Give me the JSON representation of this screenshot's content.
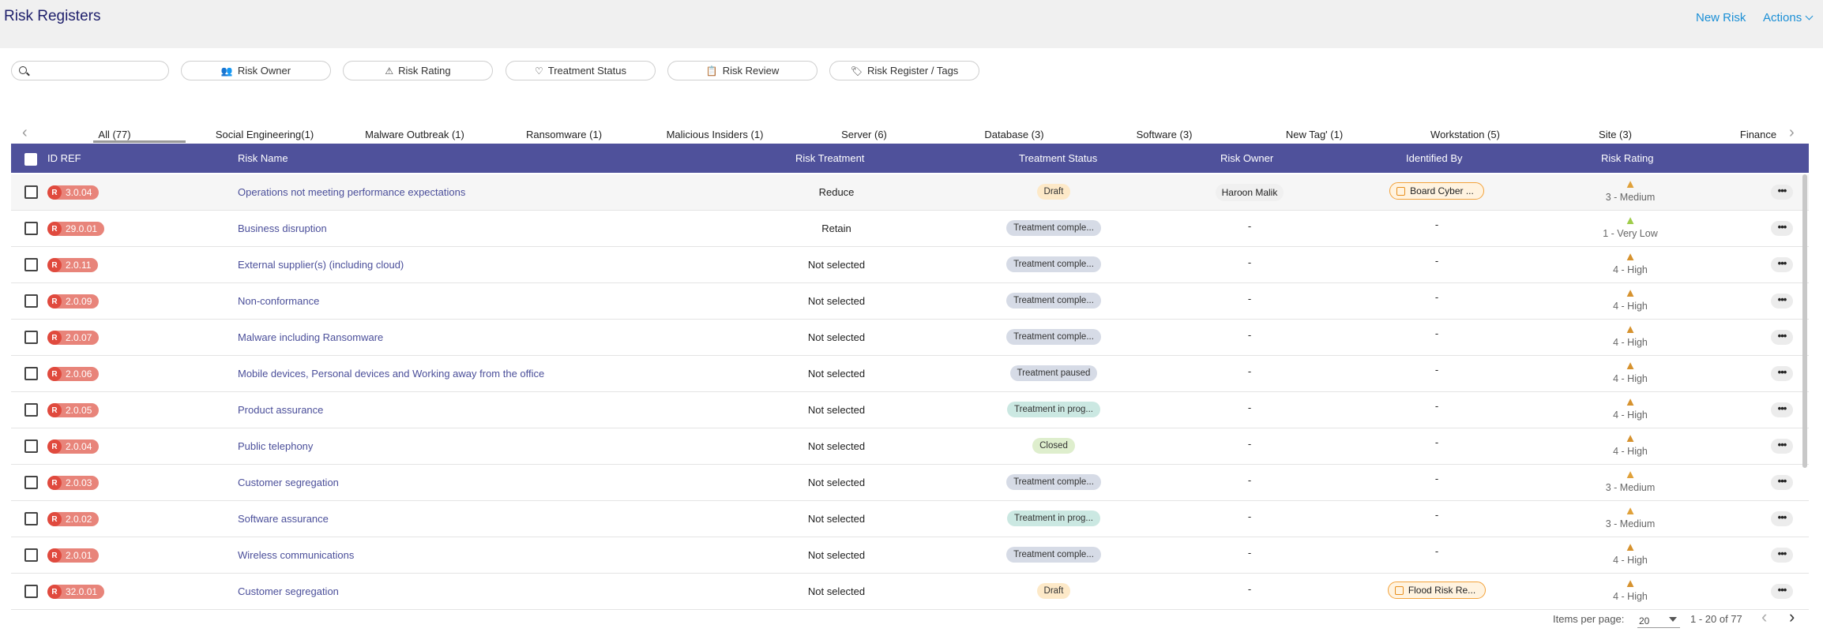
{
  "header": {
    "title": "Risk Registers",
    "new_risk_label": "New Risk",
    "actions_label": "Actions"
  },
  "search": {
    "placeholder": ""
  },
  "filters": [
    {
      "label": "Risk Owner",
      "icon": "people-icon"
    },
    {
      "label": "Risk Rating",
      "icon": "warning-icon"
    },
    {
      "label": "Treatment Status",
      "icon": "heart-icon"
    },
    {
      "label": "Risk Review",
      "icon": "clipboard-icon"
    },
    {
      "label": "Risk Register / Tags",
      "icon": "tag-icon"
    }
  ],
  "tabs": [
    "All (77)",
    "Social Engineering(1)",
    "Malware Outbreak (1)",
    "Ransomware (1)",
    "Malicious Insiders (1)",
    "Server (6)",
    "Database (3)",
    "Software (3)",
    "New Tag' (1)",
    "Workstation (5)",
    "Site (3)",
    "Finance"
  ],
  "columns": {
    "id_ref": "ID REF",
    "risk_name": "Risk Name",
    "risk_treatment": "Risk Treatment",
    "treatment_status": "Treatment Status",
    "risk_owner": "Risk Owner",
    "identified_by": "Identified By",
    "risk_rating": "Risk Rating"
  },
  "rows": [
    {
      "r": "R",
      "id": "3.0.04",
      "name": "Operations not meeting performance expectations",
      "treatment": "Reduce",
      "status": "Draft",
      "status_kind": "draft",
      "owner": "Haroon Malik",
      "identified": "Board Cyber ...",
      "rating": "3 - Medium",
      "rating_color": "#e0a13a"
    },
    {
      "r": "R",
      "id": "29.0.01",
      "name": "Business disruption",
      "treatment": "Retain",
      "status": "Treatment comple...",
      "status_kind": "complete",
      "owner": "-",
      "identified": "-",
      "rating": "1 - Very Low",
      "rating_color": "#9fcc4a"
    },
    {
      "r": "R",
      "id": "2.0.11",
      "name": "External supplier(s) (including cloud)",
      "treatment": "Not selected",
      "status": "Treatment comple...",
      "status_kind": "complete",
      "owner": "-",
      "identified": "-",
      "rating": "4 - High",
      "rating_color": "#d6922e"
    },
    {
      "r": "R",
      "id": "2.0.09",
      "name": "Non-conformance",
      "treatment": "Not selected",
      "status": "Treatment comple...",
      "status_kind": "complete",
      "owner": "-",
      "identified": "-",
      "rating": "4 - High",
      "rating_color": "#d6922e"
    },
    {
      "r": "R",
      "id": "2.0.07",
      "name": "Malware including Ransomware",
      "treatment": "Not selected",
      "status": "Treatment comple...",
      "status_kind": "complete",
      "owner": "-",
      "identified": "-",
      "rating": "4 - High",
      "rating_color": "#d6922e"
    },
    {
      "r": "R",
      "id": "2.0.06",
      "name": "Mobile devices, Personal devices and Working away from the office",
      "treatment": "Not selected",
      "status": "Treatment paused",
      "status_kind": "paused",
      "owner": "-",
      "identified": "-",
      "rating": "4 - High",
      "rating_color": "#d6922e"
    },
    {
      "r": "R",
      "id": "2.0.05",
      "name": "Product assurance",
      "treatment": "Not selected",
      "status": "Treatment in prog...",
      "status_kind": "progress",
      "owner": "-",
      "identified": "-",
      "rating": "4 - High",
      "rating_color": "#d6922e"
    },
    {
      "r": "R",
      "id": "2.0.04",
      "name": "Public telephony",
      "treatment": "Not selected",
      "status": "Closed",
      "status_kind": "closed",
      "owner": "-",
      "identified": "-",
      "rating": "4 - High",
      "rating_color": "#d6922e"
    },
    {
      "r": "R",
      "id": "2.0.03",
      "name": "Customer segregation",
      "treatment": "Not selected",
      "status": "Treatment comple...",
      "status_kind": "complete",
      "owner": "-",
      "identified": "-",
      "rating": "3 - Medium",
      "rating_color": "#e0a13a"
    },
    {
      "r": "R",
      "id": "2.0.02",
      "name": "Software assurance",
      "treatment": "Not selected",
      "status": "Treatment in prog...",
      "status_kind": "progress",
      "owner": "-",
      "identified": "-",
      "rating": "3 - Medium",
      "rating_color": "#e0a13a"
    },
    {
      "r": "R",
      "id": "2.0.01",
      "name": "Wireless communications",
      "treatment": "Not selected",
      "status": "Treatment comple...",
      "status_kind": "complete",
      "owner": "-",
      "identified": "-",
      "rating": "4 - High",
      "rating_color": "#d6922e"
    },
    {
      "r": "R",
      "id": "32.0.01",
      "name": "Customer segregation",
      "treatment": "Not selected",
      "status": "Draft",
      "status_kind": "draft",
      "owner": "-",
      "identified": "Flood Risk Re...",
      "rating": "4 - High",
      "rating_color": "#d6922e"
    }
  ],
  "pagination": {
    "items_per_page_label": "Items per page:",
    "items_per_page": "20",
    "range": "1 - 20 of 77"
  }
}
